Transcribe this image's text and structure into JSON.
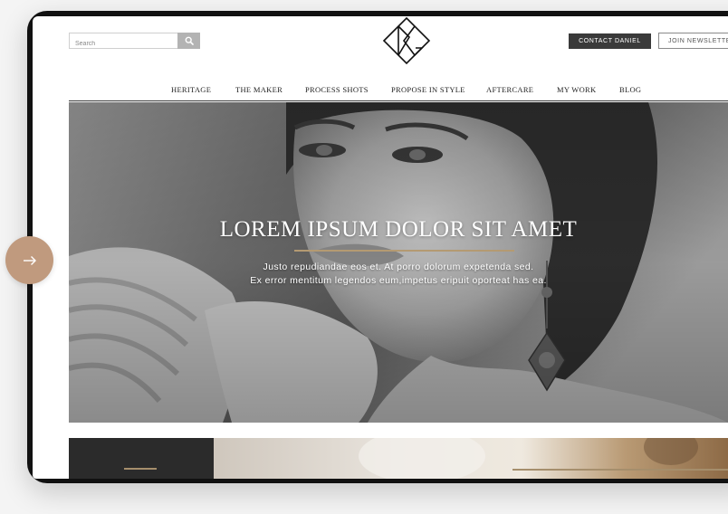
{
  "header": {
    "search": {
      "placeholder": "Search",
      "value": "",
      "icon": "search-icon"
    },
    "logo": {
      "monogram": "DG"
    },
    "contact_label": "CONTACT DANIEL",
    "newsletter_label": "JOIN NEWSLETTER"
  },
  "nav": {
    "items": [
      {
        "label": "HERITAGE"
      },
      {
        "label": "THE MAKER"
      },
      {
        "label": "PROCESS SHOTS"
      },
      {
        "label": "PROPOSE IN STYLE"
      },
      {
        "label": "AFTERCARE"
      },
      {
        "label": "MY WORK"
      },
      {
        "label": "BLOG"
      }
    ]
  },
  "hero": {
    "title": "LOREM IPSUM DOLOR SIT AMET",
    "subtitle_line1": "Justo repudiandae eos et. At porro dolorum expetenda sed.",
    "subtitle_line2": "Ex error mentitum legendos eum,impetus eripuit oporteat has ea."
  },
  "side_control": {
    "icon": "arrow-right-icon"
  },
  "colors": {
    "accent_gold": "#b49a72",
    "side_button": "#c09a7e",
    "contact_button": "#3a3a3a",
    "device_frame": "#111111"
  }
}
